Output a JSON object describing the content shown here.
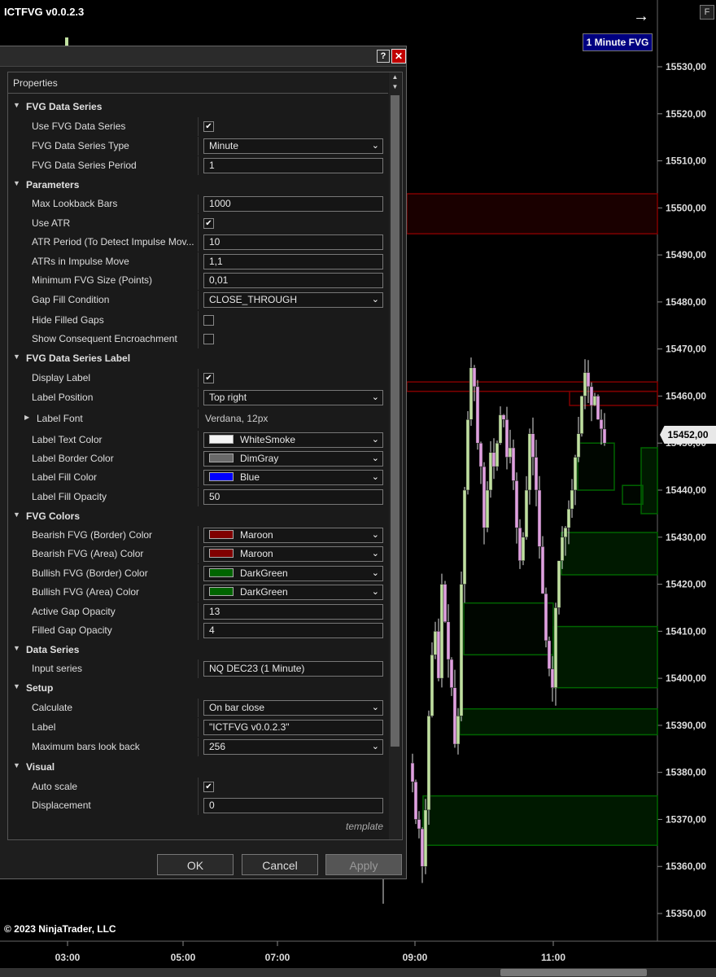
{
  "chart": {
    "title": "ICTFVG v0.0.2.3",
    "f_button": "F",
    "fvg_label": "1 Minute FVG",
    "current_price": "15452,00",
    "price_axis": [
      "15530,00",
      "15520,00",
      "15510,00",
      "15500,00",
      "15490,00",
      "15480,00",
      "15470,00",
      "15460,00",
      "15450,00",
      "15440,00",
      "15430,00",
      "15420,00",
      "15410,00",
      "15400,00",
      "15390,00",
      "15380,00",
      "15370,00",
      "15360,00",
      "15350,00"
    ],
    "time_axis": [
      "03:00",
      "05:00",
      "07:00",
      "09:00",
      "11:00"
    ],
    "copyright": "© 2023 NinjaTrader, LLC",
    "colors": {
      "bearish": "#800000",
      "bullish": "#006400",
      "candle_up": "#c0e0a0",
      "candle_down": "#e0a0e0"
    }
  },
  "dialog": {
    "help": "?",
    "close": "✕",
    "properties_header": "Properties",
    "template": "template",
    "buttons": {
      "ok": "OK",
      "cancel": "Cancel",
      "apply": "Apply"
    },
    "rows": [
      {
        "kind": "cat",
        "label": "FVG Data Series"
      },
      {
        "kind": "check",
        "label": "Use FVG Data Series",
        "checked": true
      },
      {
        "kind": "select",
        "label": "FVG Data Series Type",
        "value": "Minute"
      },
      {
        "kind": "input",
        "label": "FVG Data Series Period",
        "value": "1"
      },
      {
        "kind": "cat",
        "label": "Parameters"
      },
      {
        "kind": "input",
        "label": "Max Lookback Bars",
        "value": "1000"
      },
      {
        "kind": "check",
        "label": "Use ATR",
        "checked": true
      },
      {
        "kind": "input",
        "label": "ATR Period (To Detect Impulse Mov...",
        "value": "10"
      },
      {
        "kind": "input",
        "label": "ATRs in Impulse Move",
        "value": "1,1"
      },
      {
        "kind": "input",
        "label": "Minimum FVG Size (Points)",
        "value": "0,01"
      },
      {
        "kind": "select",
        "label": "Gap Fill Condition",
        "value": "CLOSE_THROUGH"
      },
      {
        "kind": "check",
        "label": "Hide Filled Gaps",
        "checked": false
      },
      {
        "kind": "check",
        "label": "Show Consequent Encroachment",
        "checked": false
      },
      {
        "kind": "cat",
        "label": "FVG Data Series Label"
      },
      {
        "kind": "check",
        "label": "Display Label",
        "checked": true
      },
      {
        "kind": "select",
        "label": "Label Position",
        "value": "Top right"
      },
      {
        "kind": "expand",
        "label": "Label Font",
        "value": "Verdana, 12px"
      },
      {
        "kind": "color",
        "label": "Label Text Color",
        "value": "WhiteSmoke",
        "color": "#f5f5f5"
      },
      {
        "kind": "color",
        "label": "Label Border Color",
        "value": "DimGray",
        "color": "#696969"
      },
      {
        "kind": "color",
        "label": "Label Fill Color",
        "value": "Blue",
        "color": "#0000ff"
      },
      {
        "kind": "input",
        "label": "Label Fill Opacity",
        "value": "50"
      },
      {
        "kind": "cat",
        "label": "FVG Colors"
      },
      {
        "kind": "color",
        "label": "Bearish FVG (Border) Color",
        "value": "Maroon",
        "color": "#800000"
      },
      {
        "kind": "color",
        "label": "Bearish FVG (Area) Color",
        "value": "Maroon",
        "color": "#800000"
      },
      {
        "kind": "color",
        "label": "Bullish FVG (Border) Color",
        "value": "DarkGreen",
        "color": "#006400"
      },
      {
        "kind": "color",
        "label": "Bullish FVG (Area) Color",
        "value": "DarkGreen",
        "color": "#006400"
      },
      {
        "kind": "input",
        "label": "Active Gap Opacity",
        "value": "13"
      },
      {
        "kind": "input",
        "label": "Filled Gap Opacity",
        "value": "4"
      },
      {
        "kind": "cat",
        "label": "Data Series"
      },
      {
        "kind": "input",
        "label": "Input series",
        "value": "NQ DEC23 (1 Minute)"
      },
      {
        "kind": "cat",
        "label": "Setup"
      },
      {
        "kind": "select",
        "label": "Calculate",
        "value": "On bar close"
      },
      {
        "kind": "input",
        "label": "Label",
        "value": "\"ICTFVG v0.0.2.3\""
      },
      {
        "kind": "select",
        "label": "Maximum bars look back",
        "value": "256"
      },
      {
        "kind": "cat",
        "label": "Visual"
      },
      {
        "kind": "check",
        "label": "Auto scale",
        "checked": true
      },
      {
        "kind": "input",
        "label": "Displacement",
        "value": "0"
      }
    ]
  }
}
